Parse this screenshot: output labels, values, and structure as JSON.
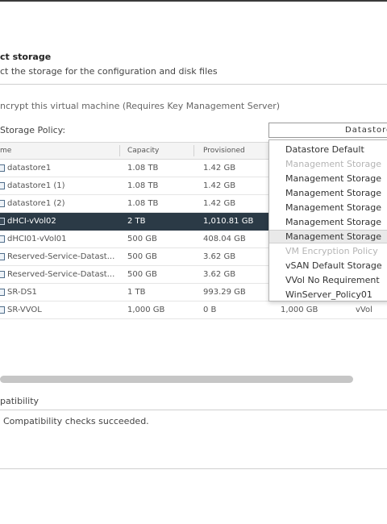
{
  "header": {
    "title": "ct storage",
    "subtitle": "ct the storage for the configuration and disk files"
  },
  "encrypt": {
    "label": "ncrypt this virtual machine (Requires Key Management Server)",
    "checked": false
  },
  "storage_policy": {
    "label": "Storage Policy:",
    "selected": "Datastore"
  },
  "table": {
    "columns": [
      "me",
      "Capacity",
      "Provisioned"
    ],
    "rows": [
      {
        "name": "datastore1",
        "capacity": "1.08 TB",
        "provisioned": "1.42 GB",
        "free": "",
        "type": ""
      },
      {
        "name": "datastore1 (1)",
        "capacity": "1.08 TB",
        "provisioned": "1.42 GB",
        "free": "",
        "type": ""
      },
      {
        "name": "datastore1 (2)",
        "capacity": "1.08 TB",
        "provisioned": "1.42 GB",
        "free": "",
        "type": ""
      },
      {
        "name": "dHCI-vVol02",
        "capacity": "2 TB",
        "provisioned": "1,010.81 GB",
        "free": "",
        "type": "",
        "selected": true
      },
      {
        "name": "dHCI01-vVol01",
        "capacity": "500 GB",
        "provisioned": "408.04 GB",
        "free": "",
        "type": ""
      },
      {
        "name": "Reserved-Service-Datast...",
        "capacity": "500 GB",
        "provisioned": "3.62 GB",
        "free": "",
        "type": ""
      },
      {
        "name": "Reserved-Service-Datast...",
        "capacity": "500 GB",
        "provisioned": "3.62 GB",
        "free": "",
        "type": ""
      },
      {
        "name": "SR-DS1",
        "capacity": "1 TB",
        "provisioned": "993.29 GB",
        "free": "",
        "type": ""
      },
      {
        "name": "SR-VVOL",
        "capacity": "1,000 GB",
        "provisioned": "0 B",
        "free": "1,000 GB",
        "type": "vVol"
      }
    ]
  },
  "dropdown_options": [
    {
      "label": "Datastore Default",
      "disabled": false
    },
    {
      "label": "Management Storage",
      "disabled": true
    },
    {
      "label": "Management Storage",
      "disabled": false
    },
    {
      "label": "Management Storage",
      "disabled": false
    },
    {
      "label": "Management Storage",
      "disabled": false
    },
    {
      "label": "Management Storage",
      "disabled": false
    },
    {
      "label": "Management Storage",
      "disabled": false,
      "highlighted": true
    },
    {
      "label": "VM Encryption Policy",
      "disabled": true
    },
    {
      "label": "vSAN Default Storage",
      "disabled": false
    },
    {
      "label": "VVol No Requirement",
      "disabled": false
    },
    {
      "label": "WinServer_Policy01",
      "disabled": false
    }
  ],
  "compatibility": {
    "label": "patibility",
    "message": "Compatibility checks succeeded."
  },
  "colors": {
    "selected_row": "#2b3a46",
    "dropdown_highlight": "#e9e9e9"
  },
  "icons": {
    "datastore": "datastore-icon"
  }
}
